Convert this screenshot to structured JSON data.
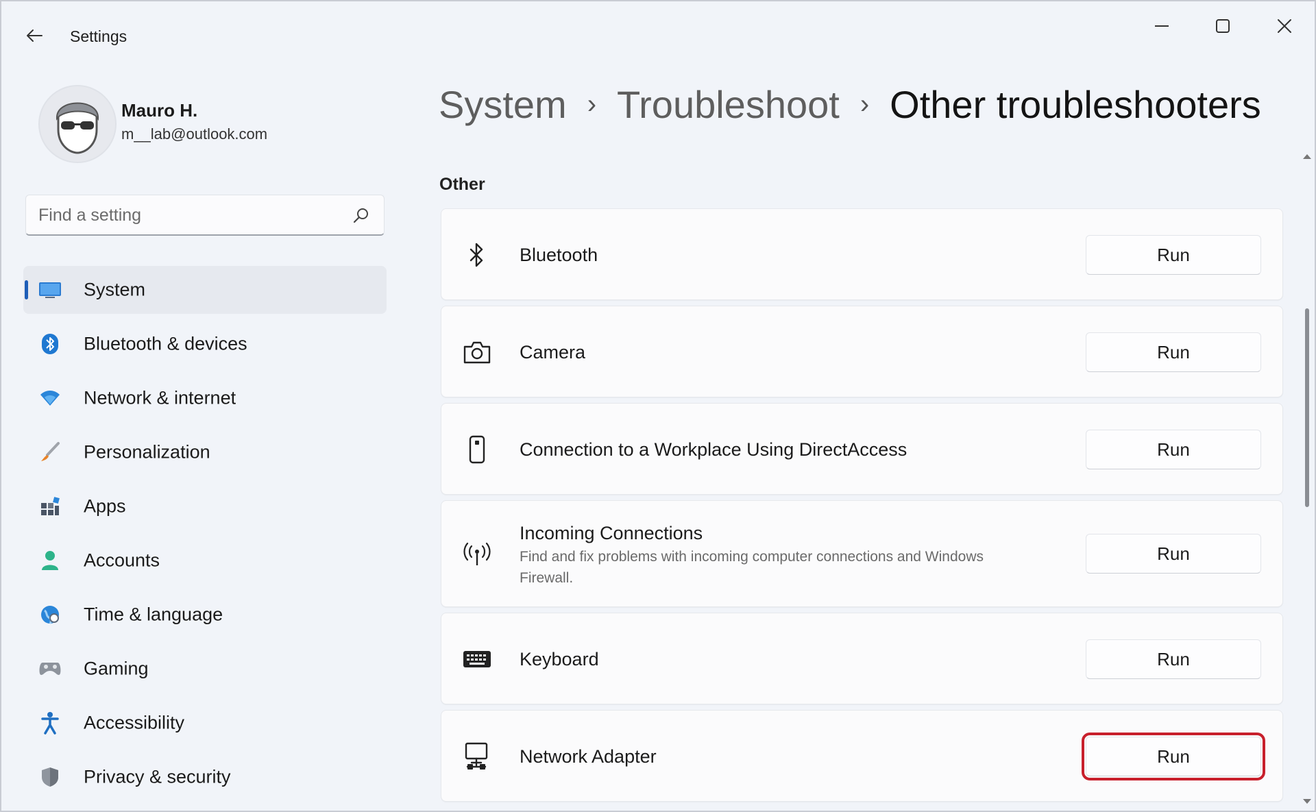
{
  "window": {
    "title": "Settings",
    "controls": {
      "minimize": "minimize-icon",
      "maximize": "maximize-icon",
      "close": "close-icon"
    }
  },
  "profile": {
    "name": "Mauro H.",
    "email": "m__lab@outlook.com"
  },
  "search": {
    "placeholder": "Find a setting",
    "value": ""
  },
  "sidebar": {
    "active": "System",
    "items": [
      {
        "label": "System",
        "icon": "monitor-icon"
      },
      {
        "label": "Bluetooth & devices",
        "icon": "bluetooth-icon"
      },
      {
        "label": "Network & internet",
        "icon": "wifi-icon"
      },
      {
        "label": "Personalization",
        "icon": "brush-icon"
      },
      {
        "label": "Apps",
        "icon": "apps-icon"
      },
      {
        "label": "Accounts",
        "icon": "person-icon"
      },
      {
        "label": "Time & language",
        "icon": "globe-clock-icon"
      },
      {
        "label": "Gaming",
        "icon": "gamepad-icon"
      },
      {
        "label": "Accessibility",
        "icon": "accessibility-icon"
      },
      {
        "label": "Privacy & security",
        "icon": "shield-icon"
      }
    ]
  },
  "breadcrumb": {
    "items": [
      "System",
      "Troubleshoot",
      "Other troubleshooters"
    ],
    "separator": "›"
  },
  "section": {
    "title": "Other"
  },
  "troubleshooters": [
    {
      "title": "Bluetooth",
      "description": "",
      "icon": "bluetooth-icon",
      "button": "Run"
    },
    {
      "title": "Camera",
      "description": "",
      "icon": "camera-icon",
      "button": "Run"
    },
    {
      "title": "Connection to a Workplace Using DirectAccess",
      "description": "",
      "icon": "phone-device-icon",
      "button": "Run"
    },
    {
      "title": "Incoming Connections",
      "description": "Find and fix problems with incoming computer connections and Windows Firewall.",
      "icon": "antenna-icon",
      "button": "Run"
    },
    {
      "title": "Keyboard",
      "description": "",
      "icon": "keyboard-icon",
      "button": "Run"
    },
    {
      "title": "Network Adapter",
      "description": "",
      "icon": "network-adapter-icon",
      "button": "Run",
      "highlighted": true
    }
  ],
  "colors": {
    "accent": "#1e5eb8",
    "highlight_box": "#c8202c",
    "background": "#f1f4f9",
    "card": "#fbfbfc"
  }
}
